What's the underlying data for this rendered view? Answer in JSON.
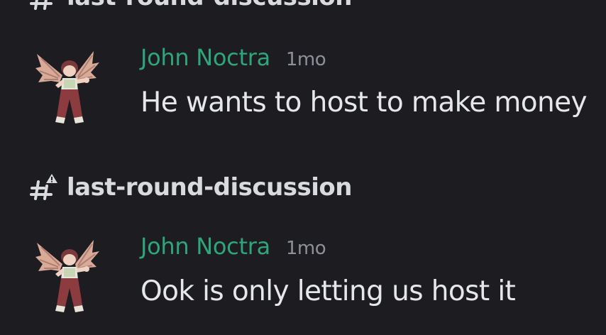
{
  "channels": {
    "top_partial": "last-round-discussion",
    "middle": "last-round-discussion",
    "icon": "text-channel-warning-icon"
  },
  "messages": [
    {
      "author": "John Noctra",
      "timestamp": "1mo",
      "content": "He wants to host to make money",
      "avatar_icon": "winged-character-avatar"
    },
    {
      "author": "John Noctra",
      "timestamp": "1mo",
      "content": "Ook is only letting us host it",
      "avatar_icon": "winged-character-avatar"
    }
  ],
  "colors": {
    "background": "#1c1c21",
    "author": "#2fa57a",
    "timestamp": "#8e9098",
    "message_text": "#e6e7ea",
    "channel_text": "#d9dade"
  }
}
